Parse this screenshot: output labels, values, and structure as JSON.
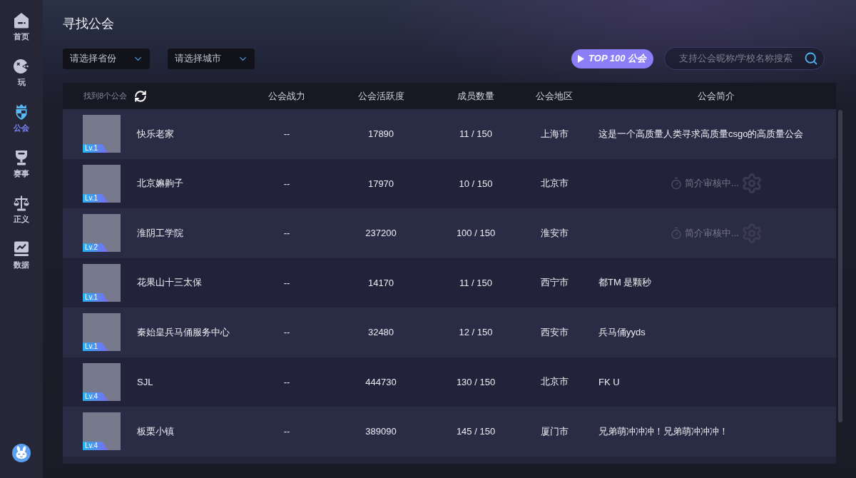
{
  "sidebar": {
    "items": [
      {
        "kind": "home",
        "label": "首页",
        "selected": false
      },
      {
        "kind": "play",
        "label": "玩",
        "selected": false
      },
      {
        "kind": "guild",
        "label": "公会",
        "selected": true
      },
      {
        "kind": "events",
        "label": "赛事",
        "selected": false
      },
      {
        "kind": "justice",
        "label": "正义",
        "selected": false
      },
      {
        "kind": "data",
        "label": "数据",
        "selected": false
      }
    ]
  },
  "page": {
    "title": "寻找公会"
  },
  "filters": [
    {
      "placeholder": "请选择省份"
    },
    {
      "placeholder": "请选择城市"
    }
  ],
  "top_button": {
    "label": "TOP 100 公会"
  },
  "search": {
    "placeholder": "支持公会昵称/学校名称搜索"
  },
  "table": {
    "result_count": "找到8个公会",
    "columns": [
      "公会战力",
      "公会活跃度",
      "成员数量",
      "公会地区",
      "公会简介"
    ],
    "rows": [
      {
        "name": "快乐老家",
        "level_badge": "Lv.1",
        "power": "--",
        "activity": "17890",
        "members": "11 / 150",
        "region": "上海市",
        "intro": {
          "kind": "text",
          "text": "这是一个高质量人类寻求高质量csgo的高质量公会"
        }
      },
      {
        "name": "北京嫲齁子",
        "level_badge": "Lv.1",
        "power": "--",
        "activity": "17970",
        "members": "10 / 150",
        "region": "北京市",
        "intro": {
          "kind": "pending",
          "text": "简介审核中..."
        }
      },
      {
        "name": "淮阴工学院",
        "level_badge": "Lv.2",
        "power": "--",
        "activity": "237200",
        "members": "100 / 150",
        "region": "淮安市",
        "intro": {
          "kind": "pending",
          "text": "简介审核中..."
        }
      },
      {
        "name": "花果山十三太保",
        "level_badge": "Lv.1",
        "power": "--",
        "activity": "14170",
        "members": "11 / 150",
        "region": "西宁市",
        "intro": {
          "kind": "text",
          "text": "都TM 是颗秒"
        }
      },
      {
        "name": "秦始皇兵马俑服务中心",
        "level_badge": "Lv.1",
        "power": "--",
        "activity": "32480",
        "members": "12 / 150",
        "region": "西安市",
        "intro": {
          "kind": "text",
          "text": "兵马俑yyds"
        }
      },
      {
        "name": "SJL",
        "level_badge": "Lv.4",
        "power": "--",
        "activity": "444730",
        "members": "130 / 150",
        "region": "北京市",
        "intro": {
          "kind": "text",
          "text": "FK U"
        }
      },
      {
        "name": "板栗小镇",
        "level_badge": "Lv.4",
        "power": "--",
        "activity": "389090",
        "members": "145 / 150",
        "region": "厦门市",
        "intro": {
          "kind": "text",
          "text": "兄弟萌冲冲冲！兄弟萌冲冲冲！"
        }
      }
    ]
  }
}
